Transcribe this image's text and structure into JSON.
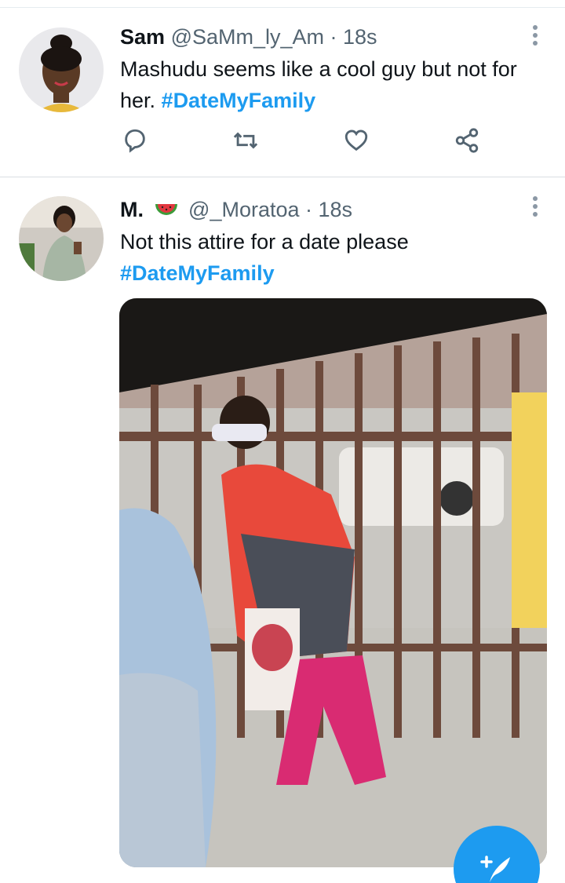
{
  "tweets": [
    {
      "name": "Sam",
      "handle": "@SaMm_ly_Am",
      "time": "· 18s",
      "text_plain": "Mashudu seems like a cool guy but not for her. ",
      "hashtag": "#DateMyFamily",
      "actions": [
        "reply-icon",
        "retweet-icon",
        "like-icon",
        "share-icon"
      ]
    },
    {
      "name": "M.",
      "handle": "@_Moratoa",
      "time": "· 18s",
      "text_plain": "Not this attire for a date  please",
      "hashtag": "#DateMyFamily",
      "emoji": "watermelon-emoji"
    }
  ],
  "colors": {
    "accent": "#1d9bf0",
    "text": "#0f1419",
    "secondary": "#536471",
    "divider": "#d9dee2"
  }
}
